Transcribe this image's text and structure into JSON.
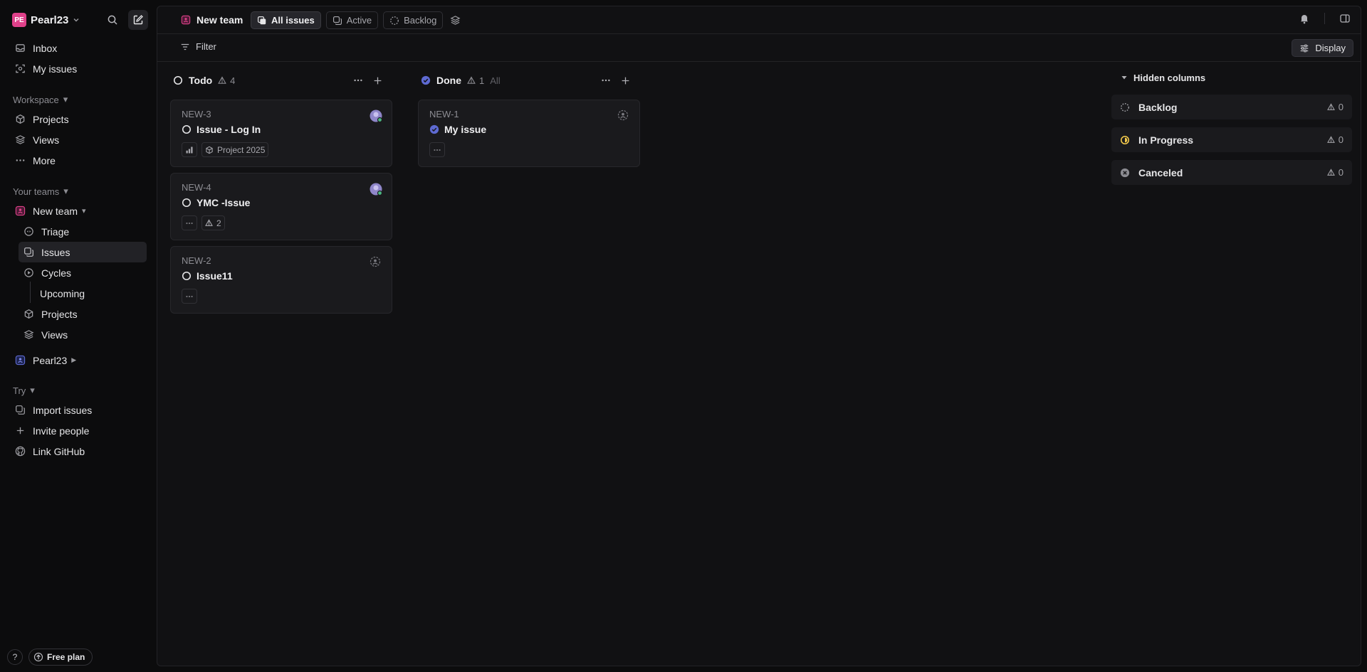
{
  "workspace": {
    "initials": "PE",
    "name": "Pearl23"
  },
  "sidebar": {
    "inbox": "Inbox",
    "my_issues": "My issues",
    "workspace_section": "Workspace",
    "projects": "Projects",
    "views": "Views",
    "more": "More",
    "teams_section": "Your teams",
    "team_name": "New team",
    "triage": "Triage",
    "issues": "Issues",
    "cycles": "Cycles",
    "upcoming": "Upcoming",
    "team_projects": "Projects",
    "team_views": "Views",
    "other_team": "Pearl23",
    "try_section": "Try",
    "import_issues": "Import issues",
    "invite_people": "Invite people",
    "link_github": "Link GitHub",
    "help": "?",
    "free_plan": "Free plan"
  },
  "header": {
    "team": "New team",
    "tabs": [
      {
        "label": "All issues",
        "icon": "all-issues-icon",
        "active": true
      },
      {
        "label": "Active",
        "icon": "active-icon",
        "active": false
      },
      {
        "label": "Backlog",
        "icon": "backlog-icon",
        "active": false
      }
    ],
    "filter": "Filter",
    "display": "Display"
  },
  "board": {
    "columns": [
      {
        "title": "Todo",
        "count": "4",
        "extra": "",
        "status": "todo",
        "cards": [
          {
            "id": "NEW-3",
            "title": "Issue - Log In",
            "props": [
              "priority",
              "Project 2025"
            ]
          },
          {
            "id": "NEW-4",
            "title": "YMC -Issue",
            "props": [
              "no-priority",
              "2"
            ]
          },
          {
            "id": "NEW-2",
            "title": "Issue11",
            "props": [
              "no-priority"
            ]
          }
        ]
      },
      {
        "title": "Done",
        "count": "1",
        "extra": "All",
        "status": "done",
        "cards": [
          {
            "id": "NEW-1",
            "title": "My issue",
            "props": [
              "no-priority"
            ]
          }
        ]
      }
    ],
    "hidden_columns": {
      "label": "Hidden columns",
      "items": [
        {
          "name": "Backlog",
          "count": "0",
          "status": "backlog"
        },
        {
          "name": "In Progress",
          "count": "0",
          "status": "in-progress"
        },
        {
          "name": "Canceled",
          "count": "0",
          "status": "canceled"
        }
      ]
    }
  },
  "colors": {
    "accent": "#5e6ad2",
    "brand": "#e0418a",
    "in_progress": "#f2c94c",
    "presence": "#4cb782"
  }
}
